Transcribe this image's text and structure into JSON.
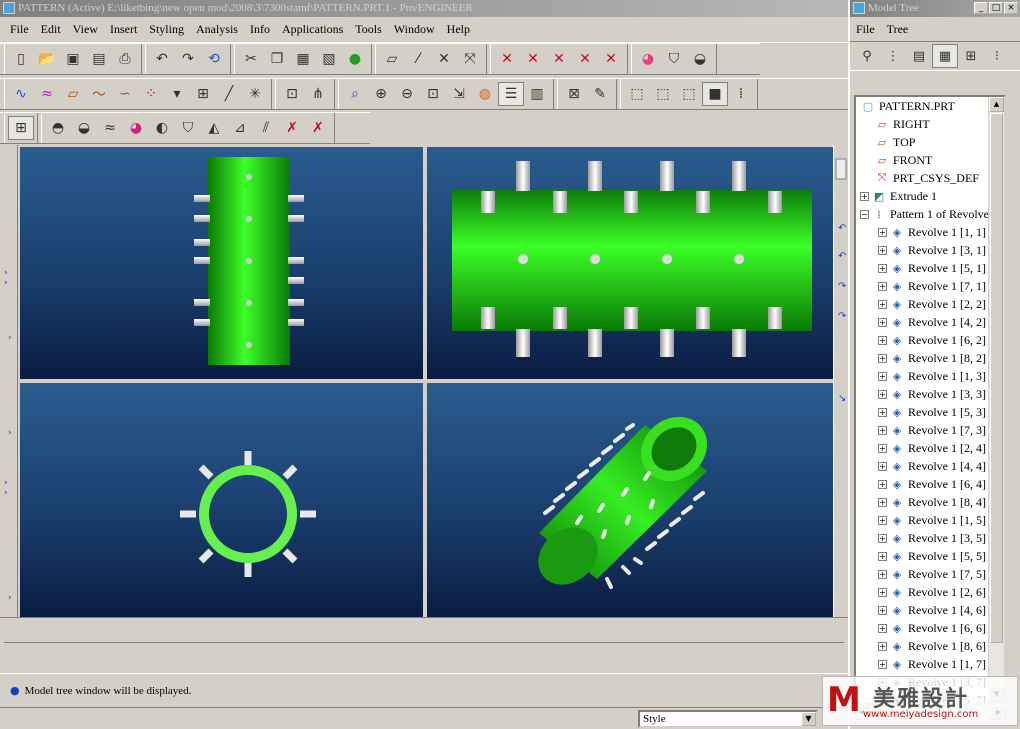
{
  "main_window": {
    "title": "PATTERN (Active) E:\\liketbing\\new open mod\\2008\\3\\7300stamf\\PATTERN.PRT.1 - Pro/ENGINEER",
    "menu": [
      "File",
      "Edit",
      "View",
      "Insert",
      "Styling",
      "Analysis",
      "Info",
      "Applications",
      "Tools",
      "Window",
      "Help"
    ]
  },
  "toolbar1": {
    "icons": [
      "new-icon",
      "open-icon",
      "save-icon",
      "save-copy-icon",
      "print-icon",
      "undo-icon",
      "redo-icon",
      "regenerate-icon",
      "cut-icon",
      "copy-icon",
      "paste-icon",
      "paste-special-icon",
      "traffic-light-icon",
      "datum-plane-display-icon",
      "datum-axis-display-icon",
      "datum-point-display-icon",
      "csys-display-icon",
      "xyz-u-icon",
      "xyz-r-icon",
      "xyz-f-icon",
      "xyz-g-icon",
      "xyz-x-icon",
      "appearance-icon",
      "model-appearance-icon",
      "shade-icon"
    ]
  },
  "toolbar2": {
    "icons": [
      "curve-icon",
      "curve-wave-icon",
      "plane-icon",
      "sketch-curve-icon",
      "spline-icon",
      "points-icon",
      "dropdown-icon",
      "grid-icon",
      "line-icon",
      "cross-icon",
      "sketch-icon",
      "network-icon",
      "zoom-area-icon",
      "zoom-in-icon",
      "zoom-out-icon",
      "refit-icon",
      "reorient-icon",
      "saved-views-icon",
      "layers-icon",
      "model-tree-icon",
      "close-window-icon",
      "edit-icon",
      "wireframe-icon",
      "hidden-line-icon",
      "no-hidden-icon",
      "shading-icon",
      "more-icon"
    ]
  },
  "toolbar3": {
    "icons": [
      "style-tree-icon",
      "surface-icon",
      "surface2-icon",
      "curve-analysis-icon",
      "color-analysis-icon",
      "shade-analysis-icon",
      "reflect-icon",
      "draft-icon",
      "slope-icon",
      "curvature-icon",
      "delete-analysis-icon",
      "delete-all-icon"
    ]
  },
  "status": {
    "message": "Model tree window will be displayed."
  },
  "bottom": {
    "select_value": "Style"
  },
  "tree_window": {
    "title": "Model Tree",
    "menu": [
      "File",
      "Tree"
    ],
    "root": "PATTERN.PRT",
    "items": [
      {
        "label": "RIGHT",
        "icon": "datum-plane-icon",
        "expandable": false,
        "indent": 1
      },
      {
        "label": "TOP",
        "icon": "datum-plane-icon",
        "expandable": false,
        "indent": 1
      },
      {
        "label": "FRONT",
        "icon": "datum-plane-icon",
        "expandable": false,
        "indent": 1
      },
      {
        "label": "PRT_CSYS_DEF",
        "icon": "csys-icon",
        "expandable": false,
        "indent": 1
      },
      {
        "label": "Extrude 1",
        "icon": "extrude-icon",
        "expandable": true,
        "indent": 0
      },
      {
        "label": "Pattern 1 of Revolve 1",
        "icon": "pattern-icon",
        "expandable": true,
        "expanded": true,
        "indent": 0
      },
      {
        "label": "Revolve 1 [1, 1]",
        "icon": "revolve-icon",
        "expandable": true,
        "indent": 2
      },
      {
        "label": "Revolve 1 [3, 1]",
        "icon": "revolve-icon",
        "expandable": true,
        "indent": 2
      },
      {
        "label": "Revolve 1 [5, 1]",
        "icon": "revolve-icon",
        "expandable": true,
        "indent": 2
      },
      {
        "label": "Revolve 1 [7, 1]",
        "icon": "revolve-icon",
        "expandable": true,
        "indent": 2
      },
      {
        "label": "Revolve 1 [2, 2]",
        "icon": "revolve-icon",
        "expandable": true,
        "indent": 2
      },
      {
        "label": "Revolve 1 [4, 2]",
        "icon": "revolve-icon",
        "expandable": true,
        "indent": 2
      },
      {
        "label": "Revolve 1 [6, 2]",
        "icon": "revolve-icon",
        "expandable": true,
        "indent": 2
      },
      {
        "label": "Revolve 1 [8, 2]",
        "icon": "revolve-icon",
        "expandable": true,
        "indent": 2
      },
      {
        "label": "Revolve 1 [1, 3]",
        "icon": "revolve-icon",
        "expandable": true,
        "indent": 2
      },
      {
        "label": "Revolve 1 [3, 3]",
        "icon": "revolve-icon",
        "expandable": true,
        "indent": 2
      },
      {
        "label": "Revolve 1 [5, 3]",
        "icon": "revolve-icon",
        "expandable": true,
        "indent": 2
      },
      {
        "label": "Revolve 1 [7, 3]",
        "icon": "revolve-icon",
        "expandable": true,
        "indent": 2
      },
      {
        "label": "Revolve 1 [2, 4]",
        "icon": "revolve-icon",
        "expandable": true,
        "indent": 2
      },
      {
        "label": "Revolve 1 [4, 4]",
        "icon": "revolve-icon",
        "expandable": true,
        "indent": 2
      },
      {
        "label": "Revolve 1 [6, 4]",
        "icon": "revolve-icon",
        "expandable": true,
        "indent": 2
      },
      {
        "label": "Revolve 1 [8, 4]",
        "icon": "revolve-icon",
        "expandable": true,
        "indent": 2
      },
      {
        "label": "Revolve 1 [1, 5]",
        "icon": "revolve-icon",
        "expandable": true,
        "indent": 2
      },
      {
        "label": "Revolve 1 [3, 5]",
        "icon": "revolve-icon",
        "expandable": true,
        "indent": 2
      },
      {
        "label": "Revolve 1 [5, 5]",
        "icon": "revolve-icon",
        "expandable": true,
        "indent": 2
      },
      {
        "label": "Revolve 1 [7, 5]",
        "icon": "revolve-icon",
        "expandable": true,
        "indent": 2
      },
      {
        "label": "Revolve 1 [2, 6]",
        "icon": "revolve-icon",
        "expandable": true,
        "indent": 2
      },
      {
        "label": "Revolve 1 [4, 6]",
        "icon": "revolve-icon",
        "expandable": true,
        "indent": 2
      },
      {
        "label": "Revolve 1 [6, 6]",
        "icon": "revolve-icon",
        "expandable": true,
        "indent": 2
      },
      {
        "label": "Revolve 1 [8, 6]",
        "icon": "revolve-icon",
        "expandable": true,
        "indent": 2
      },
      {
        "label": "Revolve 1 [1, 7]",
        "icon": "revolve-icon",
        "expandable": true,
        "indent": 2
      },
      {
        "label": "Revolve 1 [3, 7]",
        "icon": "revolve-icon",
        "expandable": true,
        "indent": 2
      },
      {
        "label": "Revolve 1 [5, 7]",
        "icon": "revolve-icon",
        "expandable": true,
        "indent": 2
      }
    ]
  },
  "watermark": {
    "brand_text": "美雅設計",
    "url": "www.meiyadesign.com"
  },
  "colors": {
    "viewport_top": "#2a5c8f",
    "viewport_bottom": "#0a1c42",
    "model_green": "#22cc11",
    "pin_white": "#e8e8e8"
  }
}
